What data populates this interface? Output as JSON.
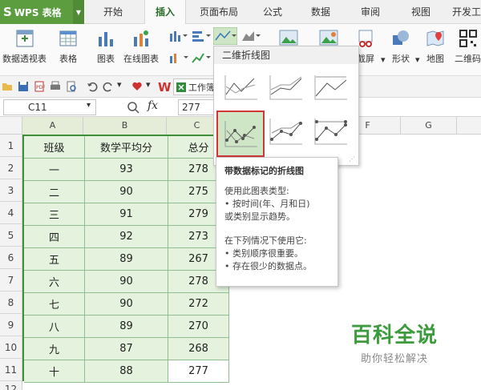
{
  "menu": {
    "app_title": "WPS 表格",
    "tabs": [
      "开始",
      "插入",
      "页面布局",
      "公式",
      "数据",
      "审阅",
      "视图",
      "开发工"
    ]
  },
  "ribbon": {
    "pivot_table": "数据透视表",
    "table": "表格",
    "chart": "图表",
    "online_chart": "在线图表",
    "screenshot": "截屏",
    "shapes": "形状",
    "map": "地图",
    "qrcode": "二维码"
  },
  "toolbar": {
    "workbook_tab": "工作簿"
  },
  "formula": {
    "cell_ref": "C11",
    "fx_symbol": "fx",
    "value": "277"
  },
  "sheet": {
    "columns": [
      "A",
      "B",
      "C",
      "F",
      "G"
    ],
    "rows": [
      "1",
      "2",
      "3",
      "4",
      "5",
      "6",
      "7",
      "8",
      "9",
      "10",
      "11",
      "12"
    ],
    "headers": [
      "班级",
      "数学平均分",
      "总分"
    ],
    "data": [
      [
        "一",
        "93",
        "278"
      ],
      [
        "二",
        "90",
        "275"
      ],
      [
        "三",
        "91",
        "279"
      ],
      [
        "四",
        "92",
        "273"
      ],
      [
        "五",
        "89",
        "267"
      ],
      [
        "六",
        "90",
        "278"
      ],
      [
        "七",
        "90",
        "272"
      ],
      [
        "八",
        "89",
        "270"
      ],
      [
        "九",
        "87",
        "268"
      ],
      [
        "十",
        "88",
        "277"
      ]
    ]
  },
  "dropdown": {
    "title": "二维折线图"
  },
  "tooltip": {
    "title": "带数据标记的折线图",
    "lines": [
      "使用此图表类型:",
      "• 按时间(年、月和日)",
      "或类别显示趋势。",
      "在下列情况下使用它:",
      "• 类别顺序很重要。",
      "• 存在很少的数据点。"
    ]
  },
  "watermark": {
    "title": "百科全说",
    "subtitle": "助你轻松解决"
  },
  "colors": {
    "accent": "#5b9d3f",
    "selection_fill": "#e4f2de",
    "selection_border": "#3f8f3a",
    "highlight_border": "#d03838"
  }
}
